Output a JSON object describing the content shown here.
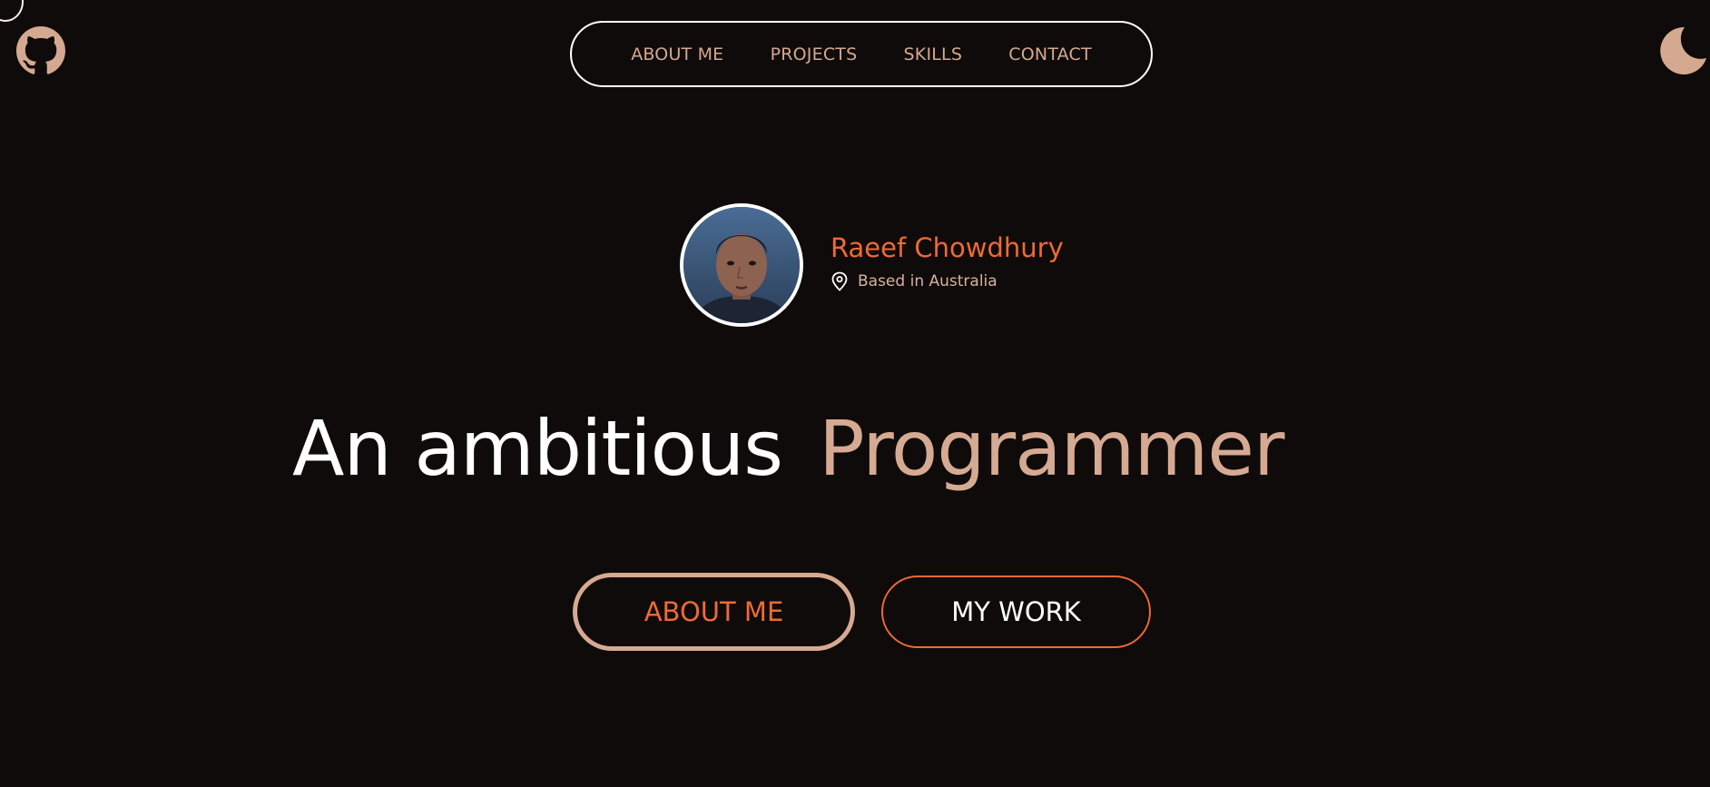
{
  "nav": {
    "items": [
      {
        "label": "ABOUT ME"
      },
      {
        "label": "PROJECTS"
      },
      {
        "label": "SKILLS"
      },
      {
        "label": "CONTACT"
      }
    ]
  },
  "header": {
    "left_icon": "github-icon",
    "right_icon": "moon-icon"
  },
  "profile": {
    "name": "Raeef Chowdhury",
    "location": "Based in Australia",
    "location_icon": "map-pin-icon"
  },
  "hero": {
    "headline_lead": "An ambitious",
    "headline_accent": "Programmer"
  },
  "buttons": {
    "about_label": "ABOUT ME",
    "work_label": "MY WORK"
  },
  "colors": {
    "background": "#0f0b0a",
    "accent_orange": "#ee6a34",
    "accent_tan": "#d6aa92",
    "text_white": "#ffffff"
  }
}
